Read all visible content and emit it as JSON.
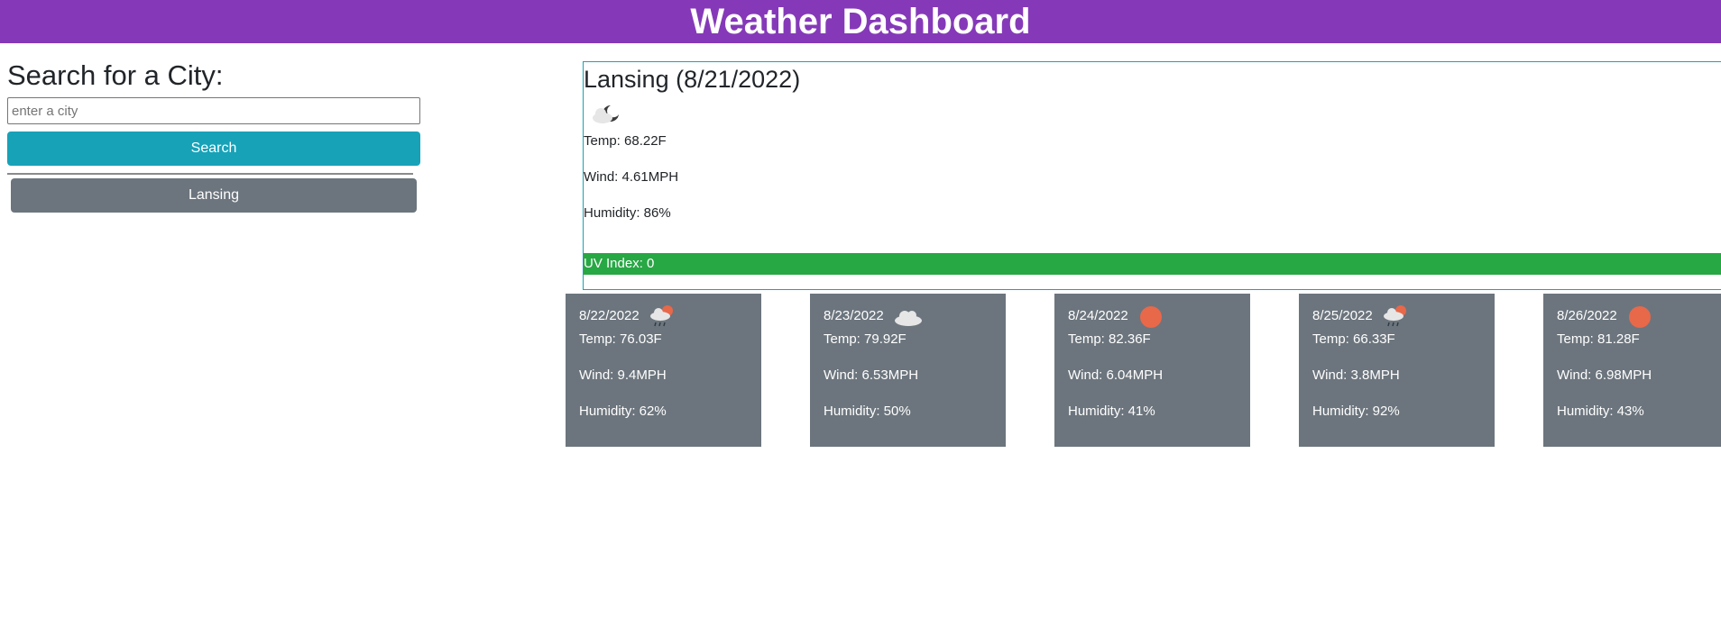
{
  "header": {
    "title": "Weather Dashboard"
  },
  "search": {
    "heading": "Search for a City:",
    "placeholder": "enter a city",
    "value": "",
    "button_label": "Search"
  },
  "history": [
    {
      "label": "Lansing"
    }
  ],
  "current": {
    "title": "Lansing (8/21/2022)",
    "icon": "partly-cloudy-night-icon",
    "temp": "Temp: 68.22F",
    "wind": "Wind: 4.61MPH",
    "humidity": "Humidity: 86%",
    "uv": "UV Index: 0",
    "uv_color": "#28a745"
  },
  "forecast": [
    {
      "date": "8/22/2022",
      "icon": "rain-sun-icon",
      "temp": "Temp: 76.03F",
      "wind": "Wind: 9.4MPH",
      "humidity": "Humidity: 62%"
    },
    {
      "date": "8/23/2022",
      "icon": "cloud-icon",
      "temp": "Temp: 79.92F",
      "wind": "Wind: 6.53MPH",
      "humidity": "Humidity: 50%"
    },
    {
      "date": "8/24/2022",
      "icon": "sun-icon",
      "temp": "Temp: 82.36F",
      "wind": "Wind: 6.04MPH",
      "humidity": "Humidity: 41%"
    },
    {
      "date": "8/25/2022",
      "icon": "rain-sun-icon",
      "temp": "Temp: 66.33F",
      "wind": "Wind: 3.8MPH",
      "humidity": "Humidity: 92%"
    },
    {
      "date": "8/26/2022",
      "icon": "sun-icon",
      "temp": "Temp: 81.28F",
      "wind": "Wind: 6.98MPH",
      "humidity": "Humidity: 43%"
    }
  ],
  "colors": {
    "header_bg": "#8539b8",
    "search_btn": "#17a2b8",
    "card_bg": "#6c757d",
    "uv_low": "#28a745",
    "sun": "#e8684a"
  }
}
